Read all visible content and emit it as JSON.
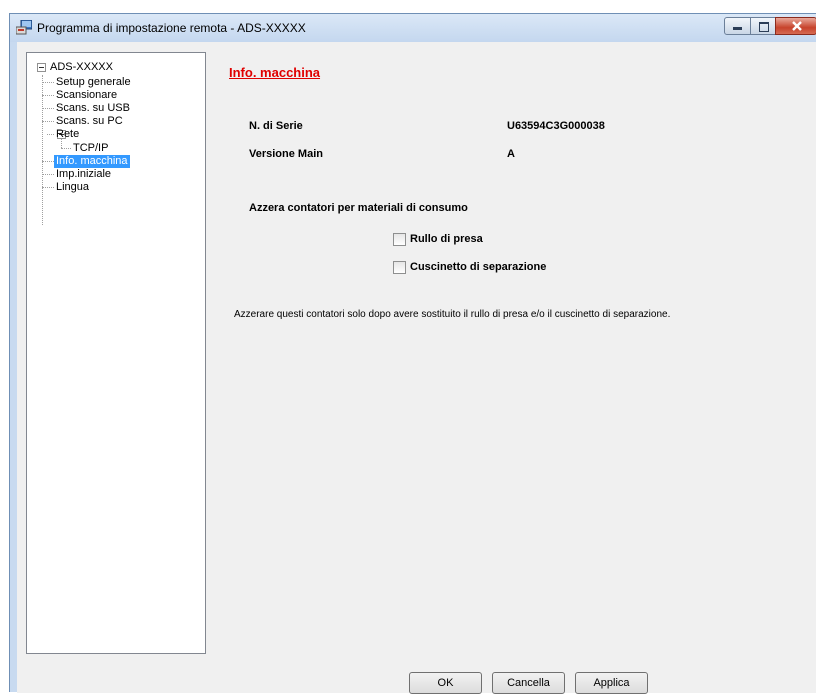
{
  "window": {
    "title": "Programma di impostazione remota - ADS-XXXXX"
  },
  "tree": {
    "root": "ADS-XXXXX",
    "items": [
      {
        "label": "Setup generale"
      },
      {
        "label": "Scansionare"
      },
      {
        "label": "Scans. su USB"
      },
      {
        "label": "Scans. su PC"
      },
      {
        "label": "Rete"
      },
      {
        "label": "TCP/IP"
      },
      {
        "label": "Info. macchina",
        "selected": true
      },
      {
        "label": "Imp.iniziale"
      },
      {
        "label": "Lingua"
      }
    ]
  },
  "panel": {
    "title": "Info. macchina",
    "serial_label": "N. di Serie",
    "serial_value": "U63594C3G000038",
    "version_label": "Versione Main",
    "version_value": "A",
    "reset_heading": "Azzera contatori per materiali di consumo",
    "checkbox_pickup": {
      "label": "Rullo di presa",
      "checked": false
    },
    "checkbox_pad": {
      "label": "Cuscinetto di separazione",
      "checked": false
    },
    "note": "Azzerare questi contatori solo dopo avere sostituito il rullo di presa e/o il cuscinetto di separazione."
  },
  "buttons": {
    "ok": "OK",
    "cancel": "Cancella",
    "apply": "Applica"
  },
  "colors": {
    "title_accent": "#e00000",
    "selection": "#3399ff",
    "close_button": "#c7432c"
  }
}
